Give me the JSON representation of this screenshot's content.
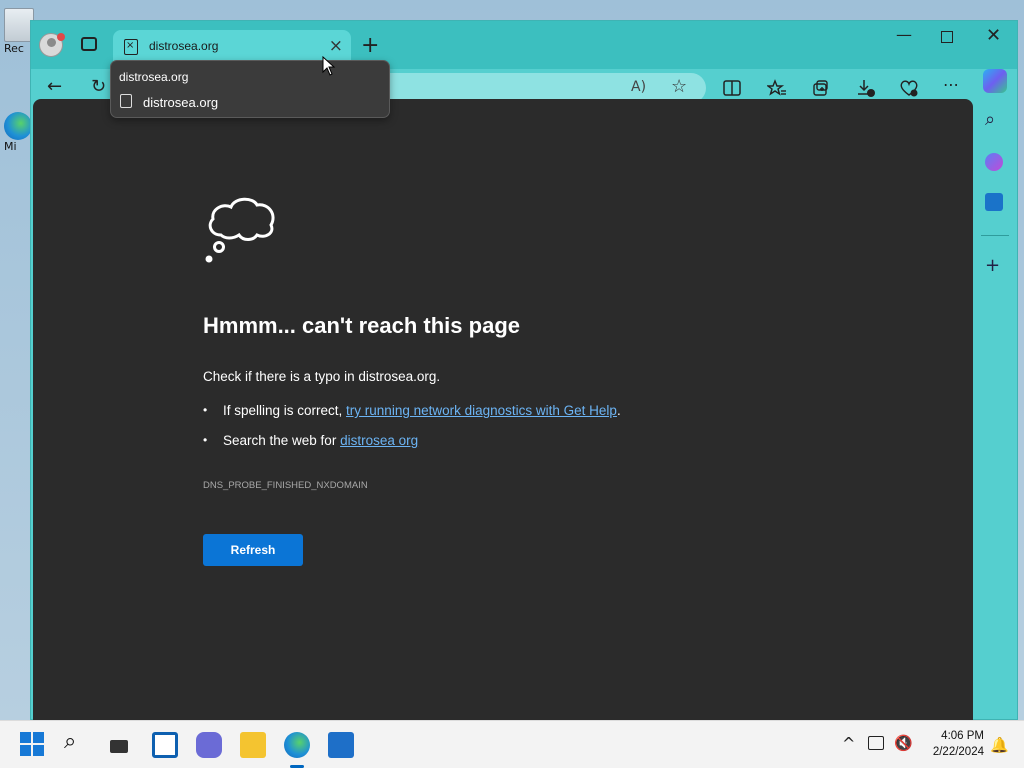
{
  "desktop": {
    "icons": [
      {
        "label": "Rec"
      },
      {
        "label": "Mi"
      }
    ]
  },
  "browser": {
    "tab": {
      "title": "distrosea.org",
      "close_glyph": "×"
    },
    "new_tab_glyph": "+",
    "window_controls": {
      "minimize": "—",
      "close": "✕"
    },
    "toolbar": {
      "back_glyph": "←",
      "reload_glyph": "↻",
      "read_aloud_glyph": "A)",
      "favorite_glyph": "☆"
    },
    "tooltip": {
      "title": "distrosea.org",
      "url": "distrosea.org"
    },
    "error_page": {
      "title": "Hmmm... can't reach this page",
      "hint": "Check if there is a typo in distrosea.org.",
      "suggestion_1_prefix": "If spelling is correct, ",
      "suggestion_1_link": "try running network diagnostics with Get Help",
      "suggestion_1_suffix": ".",
      "suggestion_2_prefix": "Search the web for ",
      "suggestion_2_link": "distrosea org",
      "error_code": "DNS_PROBE_FINISHED_NXDOMAIN",
      "refresh_label": "Refresh"
    },
    "sidebar": {
      "add_glyph": "+",
      "search_glyph": "⌕"
    }
  },
  "taskbar": {
    "search_glyph": "⌕",
    "tray_chevron": "^",
    "time": "4:06 PM",
    "date": "2/22/2024"
  },
  "colors": {
    "accent": "#55cfcf",
    "error_page_bg": "#2b2b2b",
    "link": "#6cb4f4",
    "refresh_button": "#0b75d6"
  }
}
